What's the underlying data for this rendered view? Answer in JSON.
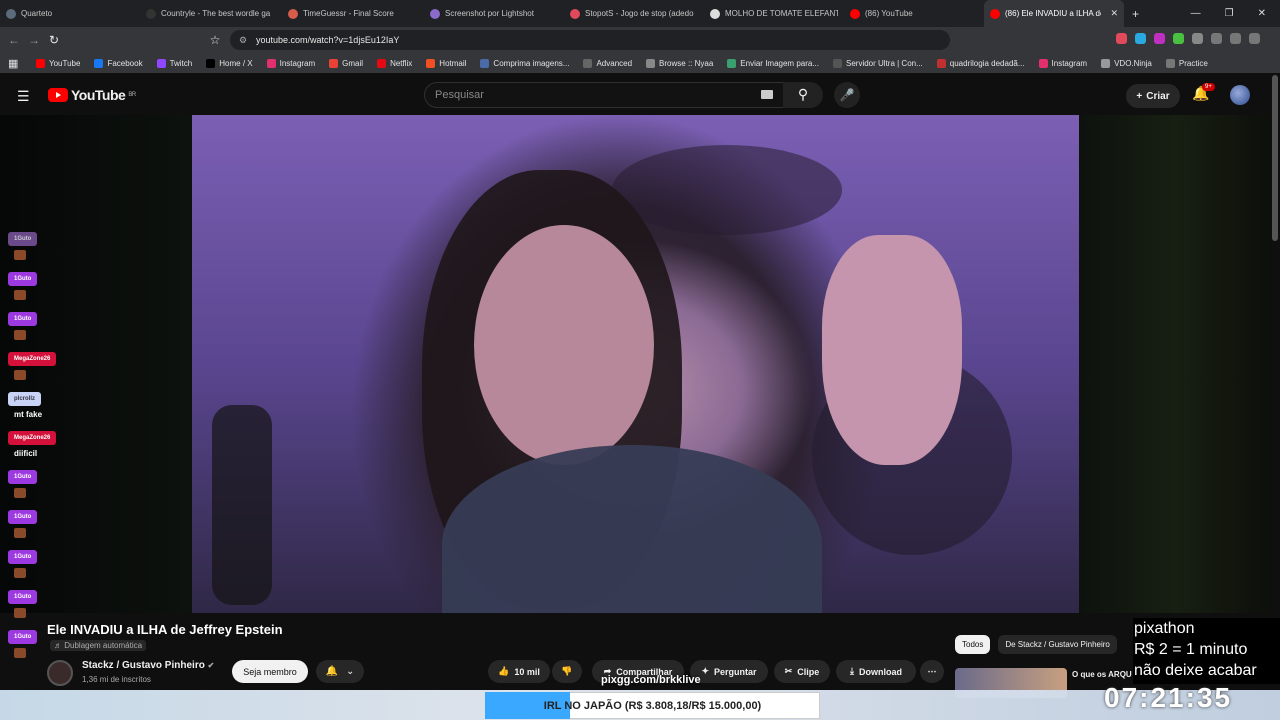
{
  "browser": {
    "tabs": [
      {
        "label": "Quarteto",
        "color": "#5b6b7b"
      },
      {
        "label": "Countryle - The best wordle ga",
        "color": "#333333"
      },
      {
        "label": "TimeGuessr - Final Score",
        "color": "#d65c4c"
      },
      {
        "label": "Screenshot por Lightshot",
        "color": "#8a6acb"
      },
      {
        "label": "StopotS - Jogo de stop (adedo",
        "color": "#e04a5a"
      },
      {
        "label": "MOLHO DE TOMATE ELEFANTE",
        "color": "#dddddd"
      },
      {
        "label": "(86) YouTube",
        "color": "#ff0000"
      },
      {
        "label": "(86) Ele INVADIU a ILHA de",
        "color": "#ff0000"
      }
    ],
    "url": "youtube.com/watch?v=1djsEu12IaY",
    "bookmarks": [
      {
        "label": "YouTube",
        "color": "#ff0000"
      },
      {
        "label": "Facebook",
        "color": "#1877f2"
      },
      {
        "label": "Twitch",
        "color": "#9146ff"
      },
      {
        "label": "Home / X",
        "color": "#000000"
      },
      {
        "label": "Instagram",
        "color": "#e1306c"
      },
      {
        "label": "Gmail",
        "color": "#ea4335"
      },
      {
        "label": "Netflix",
        "color": "#e50914"
      },
      {
        "label": "Hotmail",
        "color": "#f25022"
      },
      {
        "label": "Comprima imagens...",
        "color": "#4a6aa8"
      },
      {
        "label": "Advanced",
        "color": "#666666"
      },
      {
        "label": "Browse :: Nyaa",
        "color": "#888888"
      },
      {
        "label": "Enviar Imagem para...",
        "color": "#3aa070"
      },
      {
        "label": "Servidor Ultra | Con...",
        "color": "#555555"
      },
      {
        "label": "quadrilogia dedadã...",
        "color": "#c03030"
      },
      {
        "label": "Instagram",
        "color": "#e1306c"
      },
      {
        "label": "VDO.Ninja",
        "color": "#999999"
      },
      {
        "label": "Practice",
        "color": "#777777"
      }
    ]
  },
  "youtube": {
    "logo_text": "YouTube",
    "logo_region": "BR",
    "search_placeholder": "Pesquisar",
    "create_label": "Criar",
    "notification_count": "9+"
  },
  "chat": [
    {
      "user": "1Guto",
      "style": "faded",
      "emote": true,
      "text": ""
    },
    {
      "user": "1Guto",
      "style": "purple",
      "emote": true,
      "text": ""
    },
    {
      "user": "1Guto",
      "style": "purple",
      "emote": true,
      "text": ""
    },
    {
      "user": "MegaZone26",
      "style": "red",
      "emote": true,
      "text": ""
    },
    {
      "user": "plcrollz",
      "style": "light",
      "emote": false,
      "text": "mt fake"
    },
    {
      "user": "MegaZone26",
      "style": "red",
      "emote": false,
      "text": "diificil"
    },
    {
      "user": "1Guto",
      "style": "purple",
      "emote": true,
      "text": ""
    },
    {
      "user": "1Guto",
      "style": "purple",
      "emote": true,
      "text": ""
    },
    {
      "user": "1Guto",
      "style": "purple",
      "emote": true,
      "text": ""
    },
    {
      "user": "1Guto",
      "style": "purple",
      "emote": true,
      "text": ""
    },
    {
      "user": "1Guto",
      "style": "purple",
      "emote": true,
      "text": ""
    }
  ],
  "video": {
    "title": "Ele INVADIU a ILHA de Jeffrey Epstein",
    "dubbing": "Dublagem automática",
    "channel": "Stackz / Gustavo Pinheiro",
    "subscribers": "1,36 mi de inscritos",
    "member_label": "Seja membro",
    "likes": "10 mil",
    "share_label": "Compartilhar",
    "ask_label": "Perguntar",
    "clip_label": "Clipe",
    "download_label": "Download"
  },
  "sidebar": {
    "chips": [
      "Todos",
      "De Stackz / Gustavo Pinheiro"
    ],
    "next_title": "O que os ARQU"
  },
  "overlay": {
    "pixathon_lines": [
      "pixathon",
      "R$ 2 = 1 minuto",
      "não deixe acabar"
    ],
    "pix_url": "pixgg.com/brkklive",
    "goal_text": "IRL NO JAPÃO (R$ 3.808,18/R$ 15.000,00)",
    "goal_progress": 0.254,
    "timer": "07:21:35"
  }
}
